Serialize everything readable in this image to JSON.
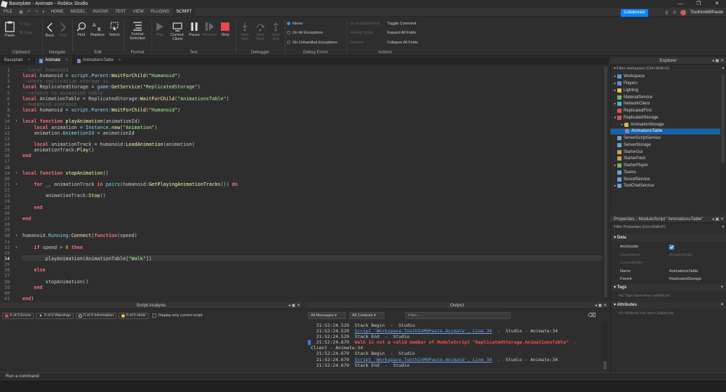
{
  "window": {
    "title": "Baseplate - Animate - Roblox Studio",
    "btn_min": "—",
    "btn_max": "❐",
    "btn_close": "✕"
  },
  "menubar": {
    "tabs": [
      "FILE",
      "HOME",
      "MODEL",
      "AVATAR",
      "TEST",
      "VIEW",
      "PLUGINS",
      "SCRIPT"
    ],
    "active": "SCRIPT",
    "collaborate": "Collaborate",
    "username": "ToothInM9Paste"
  },
  "ribbon": {
    "clipboard": {
      "paste": "Paste",
      "cut": "Cut",
      "copy": "Copy",
      "label": "Clipboard"
    },
    "navigate": {
      "back": "Back",
      "fwd": "Fwd",
      "label": "Navigate"
    },
    "edit": {
      "find": "Find",
      "replace": "Replace",
      "select": "Select",
      "label": "Edit"
    },
    "format": {
      "format_selection": "Format Selection",
      "label": "Format"
    },
    "test": {
      "play": "Play",
      "current_client": "Current: Client",
      "pause": "Pause",
      "resume": "Resume",
      "stop": "Stop",
      "label": "Test"
    },
    "debugger": {
      "step_into": "Step Into",
      "step_over": "Step Over",
      "step_out": "Step Out",
      "label": "Debugger"
    },
    "debug_errors": {
      "never": "Never",
      "on_all": "On All Exceptions",
      "on_unhandled": "On Unhandled Exceptions",
      "label": "Debug Errors"
    },
    "actions": {
      "goto_error": "Go to Script Error",
      "reload": "Reload Script",
      "commit": "Commit",
      "toggle_comment": "Toggle Comment",
      "expand_all": "Expand All Folds",
      "collapse_all": "Collapse All Folds",
      "label": "Actions"
    }
  },
  "tabs": [
    {
      "label": "Baseplate",
      "active": false
    },
    {
      "label": "Animate",
      "active": true
    },
    {
      "label": "AnimationsTable",
      "active": false
    }
  ],
  "editor": {
    "current_line": 34,
    "lines": [
      {
        "n": 1,
        "fold": false,
        "tokens": [
          [
            "cm",
            "--local humanoid"
          ]
        ]
      },
      {
        "n": 2,
        "fold": false,
        "tokens": [
          [
            "kw",
            "local"
          ],
          [
            "t",
            " humanoid = "
          ],
          [
            "bi",
            "script"
          ],
          [
            "t",
            "."
          ],
          [
            "bi",
            "Parent"
          ],
          [
            "t",
            ":"
          ],
          [
            "fn",
            "WaitForChild"
          ],
          [
            "t",
            "("
          ],
          [
            "st",
            "\"Humanoid\""
          ],
          [
            "t",
            ")"
          ]
        ]
      },
      {
        "n": 3,
        "fold": false,
        "tokens": [
          [
            "cm",
            "--where replication storage is"
          ]
        ]
      },
      {
        "n": 4,
        "fold": false,
        "tokens": [
          [
            "kw",
            "local"
          ],
          [
            "t",
            " ReplicatedStorage = "
          ],
          [
            "bi",
            "game"
          ],
          [
            "t",
            ":"
          ],
          [
            "fn",
            "GetService"
          ],
          [
            "t",
            "("
          ],
          [
            "st",
            "\"ReplicatedStorage\""
          ],
          [
            "t",
            ")"
          ]
        ]
      },
      {
        "n": 5,
        "fold": false,
        "tokens": [
          [
            "cm",
            "--refence to animation table"
          ]
        ]
      },
      {
        "n": 6,
        "fold": false,
        "tokens": [
          [
            "kw",
            "local"
          ],
          [
            "t",
            " AnimationTable = ReplicatedStorage:"
          ],
          [
            "fn",
            "WaitForChild"
          ],
          [
            "t",
            "("
          ],
          [
            "st",
            "\"AnimationsTable\""
          ],
          [
            "t",
            ")"
          ]
        ]
      },
      {
        "n": 7,
        "fold": false,
        "tokens": [
          [
            "cm",
            "--humanoid instance"
          ]
        ]
      },
      {
        "n": 8,
        "fold": false,
        "tokens": [
          [
            "kw",
            "local"
          ],
          [
            "t",
            " humanoid = "
          ],
          [
            "bi",
            "script"
          ],
          [
            "t",
            "."
          ],
          [
            "bi",
            "Parent"
          ],
          [
            "t",
            ":"
          ],
          [
            "fn",
            "WaitForChild"
          ],
          [
            "t",
            "("
          ],
          [
            "st",
            "\"Humanoid\""
          ],
          [
            "t",
            ")"
          ]
        ]
      },
      {
        "n": 9,
        "fold": false,
        "tokens": []
      },
      {
        "n": 10,
        "fold": true,
        "tokens": [
          [
            "kw",
            "local function"
          ],
          [
            "t",
            " "
          ],
          [
            "fn",
            "playAnimation"
          ],
          [
            "t",
            "(animationId)"
          ]
        ]
      },
      {
        "n": 11,
        "fold": false,
        "tokens": [
          [
            "t",
            "    "
          ],
          [
            "kw",
            "local"
          ],
          [
            "t",
            " animation = "
          ],
          [
            "bi",
            "Instance"
          ],
          [
            "t",
            "."
          ],
          [
            "fn",
            "new"
          ],
          [
            "t",
            "("
          ],
          [
            "st",
            "\"Animation\""
          ],
          [
            "t",
            ")"
          ]
        ]
      },
      {
        "n": 12,
        "fold": false,
        "tokens": [
          [
            "t",
            "    animation."
          ],
          [
            "bi",
            "AnimationId"
          ],
          [
            "t",
            " = animationId"
          ]
        ]
      },
      {
        "n": 13,
        "fold": false,
        "tokens": []
      },
      {
        "n": 14,
        "fold": false,
        "tokens": [
          [
            "t",
            "    "
          ],
          [
            "kw",
            "local"
          ],
          [
            "t",
            " animationTrack = humanoid:"
          ],
          [
            "fn",
            "LoadAnimation"
          ],
          [
            "t",
            "(animation)"
          ]
        ]
      },
      {
        "n": 15,
        "fold": false,
        "tokens": [
          [
            "t",
            "    animationTrack:"
          ],
          [
            "fn",
            "Play"
          ],
          [
            "t",
            "()"
          ]
        ]
      },
      {
        "n": 16,
        "fold": false,
        "tokens": [
          [
            "kw",
            "end"
          ]
        ]
      },
      {
        "n": 17,
        "fold": false,
        "tokens": []
      },
      {
        "n": 18,
        "fold": false,
        "tokens": []
      },
      {
        "n": 19,
        "fold": true,
        "tokens": [
          [
            "kw",
            "local function"
          ],
          [
            "t",
            " "
          ],
          [
            "fn",
            "stopAnimation"
          ],
          [
            "t",
            "()"
          ]
        ]
      },
      {
        "n": 20,
        "fold": false,
        "tokens": []
      },
      {
        "n": 21,
        "fold": true,
        "tokens": [
          [
            "t",
            "    "
          ],
          [
            "kw",
            "for"
          ],
          [
            "t",
            " _, animationTrack "
          ],
          [
            "kw",
            "in"
          ],
          [
            "t",
            " "
          ],
          [
            "bi",
            "pairs"
          ],
          [
            "t",
            "(humanoid:"
          ],
          [
            "fn",
            "GetPlayingAnimationTracks"
          ],
          [
            "t",
            "()) "
          ],
          [
            "kw",
            "do"
          ]
        ]
      },
      {
        "n": 22,
        "fold": false,
        "tokens": []
      },
      {
        "n": 23,
        "fold": false,
        "tokens": [
          [
            "t",
            "        animationTrack:"
          ],
          [
            "fn",
            "Stop"
          ],
          [
            "t",
            "()"
          ]
        ]
      },
      {
        "n": 24,
        "fold": false,
        "tokens": []
      },
      {
        "n": 25,
        "fold": false,
        "tokens": [
          [
            "t",
            "    "
          ],
          [
            "kw",
            "end"
          ]
        ]
      },
      {
        "n": 26,
        "fold": false,
        "tokens": []
      },
      {
        "n": 27,
        "fold": false,
        "tokens": [
          [
            "kw",
            "end"
          ]
        ]
      },
      {
        "n": 28,
        "fold": false,
        "tokens": []
      },
      {
        "n": 29,
        "fold": false,
        "tokens": []
      },
      {
        "n": 30,
        "fold": true,
        "tokens": [
          [
            "t",
            "humanoid."
          ],
          [
            "bi",
            "Running"
          ],
          [
            "t",
            ":"
          ],
          [
            "fn",
            "Connect"
          ],
          [
            "t",
            "("
          ],
          [
            "kw",
            "function"
          ],
          [
            "t",
            "(speed)"
          ]
        ]
      },
      {
        "n": 31,
        "fold": false,
        "tokens": []
      },
      {
        "n": 32,
        "fold": true,
        "tokens": [
          [
            "t",
            "    "
          ],
          [
            "kw",
            "if"
          ],
          [
            "t",
            " speed > "
          ],
          [
            "nu",
            "0"
          ],
          [
            "t",
            " "
          ],
          [
            "kw",
            "then"
          ]
        ]
      },
      {
        "n": 33,
        "fold": false,
        "tokens": []
      },
      {
        "n": 34,
        "fold": false,
        "tokens": [
          [
            "t",
            "        playAnimation(AnimationTable["
          ],
          [
            "st",
            "\"Walk\""
          ],
          [
            "t",
            "])"
          ]
        ]
      },
      {
        "n": 35,
        "fold": false,
        "tokens": []
      },
      {
        "n": 36,
        "fold": false,
        "tokens": [
          [
            "t",
            "    "
          ],
          [
            "kw",
            "else"
          ]
        ]
      },
      {
        "n": 37,
        "fold": false,
        "tokens": []
      },
      {
        "n": 38,
        "fold": false,
        "tokens": [
          [
            "t",
            "        stopAnimation()"
          ]
        ]
      },
      {
        "n": 39,
        "fold": false,
        "tokens": [
          [
            "t",
            "    "
          ],
          [
            "kw",
            "end"
          ]
        ]
      },
      {
        "n": 40,
        "fold": false,
        "tokens": []
      },
      {
        "n": 41,
        "fold": false,
        "tokens": [
          [
            "kw",
            "end"
          ],
          [
            "t",
            ")"
          ]
        ]
      }
    ]
  },
  "script_analysis": {
    "title": "Script Analysis",
    "errors": "0 of 0 Errors",
    "warnings": "0 of 0 Warnings",
    "info": "0 of 0 Information",
    "hints": "0 of 0 Hints",
    "only_current": "Display only current script"
  },
  "output": {
    "title": "Output",
    "messages_filter": "All Messages",
    "contexts_filter": "All Contexts",
    "filter_placeholder": "Filter...",
    "lines": [
      {
        "time": "21:52:24.529",
        "parts": [
          [
            "n",
            "Stack Begin  -  Studio"
          ]
        ]
      },
      {
        "time": "21:52:24.529",
        "parts": [
          [
            "link",
            "Script 'Workspace.ToothInM9Paste.Animate', Line 34"
          ],
          [
            "n",
            "  -  Studio - Animate:34"
          ]
        ]
      },
      {
        "time": "21:52:24.529",
        "parts": [
          [
            "n",
            "Stack End  -  Studio"
          ]
        ]
      },
      {
        "time": "21:52:24.679",
        "mark": true,
        "parts": [
          [
            "err",
            "Walk is not a valid member of ModuleScript \"ReplicatedStorage.AnimationsTable\""
          ],
          [
            "n",
            "  -"
          ]
        ]
      },
      {
        "time": "",
        "parts": [
          [
            "n",
            "Client - Animate:34"
          ]
        ]
      },
      {
        "time": "21:52:24.679",
        "parts": [
          [
            "n",
            "Stack Begin  -  Studio"
          ]
        ]
      },
      {
        "time": "21:52:24.679",
        "parts": [
          [
            "link",
            "Script 'Workspace.ToothInM9Paste.Animate', Line 34"
          ],
          [
            "n",
            "  -  Studio - Animate:34"
          ]
        ]
      },
      {
        "time": "21:52:24.679",
        "parts": [
          [
            "n",
            "Stack End  -  Studio"
          ]
        ]
      }
    ]
  },
  "command_bar": {
    "placeholder": "Run a command"
  },
  "explorer": {
    "title": "Explorer",
    "filter": "Filter workspace (Ctrl+Shift+X)",
    "items": [
      {
        "label": "Workspace",
        "indent": 0,
        "expand": "▸",
        "color": "#4a9be0",
        "selected": false
      },
      {
        "label": "Players",
        "indent": 0,
        "expand": "▸",
        "color": "#5c8ed6",
        "selected": false
      },
      {
        "label": "Lighting",
        "indent": 0,
        "expand": "▸",
        "color": "#e8c04a",
        "selected": false
      },
      {
        "label": "MaterialService",
        "indent": 0,
        "expand": "",
        "color": "#6fb86f",
        "selected": false
      },
      {
        "label": "NetworkClient",
        "indent": 0,
        "expand": "▸",
        "color": "#4fb3c9",
        "selected": false
      },
      {
        "label": "ReplicatedFirst",
        "indent": 0,
        "expand": "",
        "color": "#d9534f",
        "selected": false
      },
      {
        "label": "ReplicatedStorage",
        "indent": 0,
        "expand": "▾",
        "color": "#d9534f",
        "selected": false
      },
      {
        "label": "AnimationStorage",
        "indent": 1,
        "expand": "▸",
        "color": "#e0b34a",
        "selected": false
      },
      {
        "label": "AnimationsTable",
        "indent": 1,
        "expand": "",
        "color": "#8a7fd8",
        "selected": true
      },
      {
        "label": "ServerScriptService",
        "indent": 0,
        "expand": "",
        "color": "#6fa0d8",
        "selected": false
      },
      {
        "label": "ServerStorage",
        "indent": 0,
        "expand": "",
        "color": "#6fa0d8",
        "selected": false
      },
      {
        "label": "StarterGui",
        "indent": 0,
        "expand": "",
        "color": "#c9a25a",
        "selected": false
      },
      {
        "label": "StarterPack",
        "indent": 0,
        "expand": "",
        "color": "#c9a25a",
        "selected": false
      },
      {
        "label": "StarterPlayer",
        "indent": 0,
        "expand": "▸",
        "color": "#6fb86f",
        "selected": false
      },
      {
        "label": "Teams",
        "indent": 0,
        "expand": "",
        "color": "#6fa0d8",
        "selected": false
      },
      {
        "label": "SoundService",
        "indent": 0,
        "expand": "",
        "color": "#6fa0d8",
        "selected": false
      },
      {
        "label": "TextChatService",
        "indent": 0,
        "expand": "▸",
        "color": "#6fa0d8",
        "selected": false
      }
    ]
  },
  "properties": {
    "title": "Properties - ModuleScript \"AnimationsTable\"",
    "filter": "Filter Properties (Ctrl+Shift+P)",
    "data_section": "Data",
    "rows": [
      {
        "key": "Archivable",
        "value": "",
        "checkbox": true,
        "dim": false
      },
      {
        "key": "ClassName",
        "value": "ModuleScript",
        "checkbox": false,
        "dim": true
      },
      {
        "key": "CurrentEditor",
        "value": "",
        "checkbox": false,
        "dim": true
      },
      {
        "key": "Name",
        "value": "AnimationsTable",
        "checkbox": false,
        "dim": false
      },
      {
        "key": "Parent",
        "value": "ReplicatedStorage",
        "checkbox": false,
        "dim": false
      }
    ],
    "tags_section": "Tags",
    "tags_empty": "No Tags have been added yet",
    "attributes_section": "Attributes",
    "attributes_empty": "No Attribute has been added yet"
  }
}
